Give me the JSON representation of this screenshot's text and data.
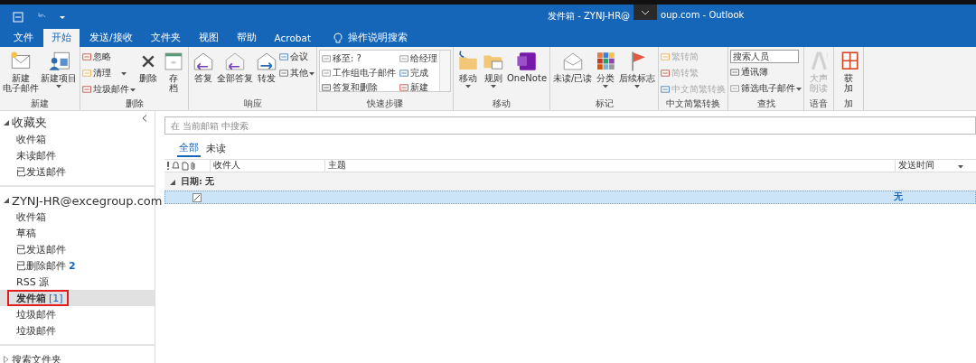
{
  "window": {
    "title_before": "发件箱 - ZYNJ-HR@",
    "title_after": "oup.com  -  Outlook"
  },
  "menu_tabs": [
    {
      "label": "文件",
      "selected": false
    },
    {
      "label": "开始",
      "selected": true
    },
    {
      "label": "发送/接收",
      "selected": false
    },
    {
      "label": "文件夹",
      "selected": false
    },
    {
      "label": "视图",
      "selected": false
    },
    {
      "label": "帮助",
      "selected": false
    },
    {
      "label": "Acrobat",
      "selected": false
    }
  ],
  "tell_me": {
    "label": "操作说明搜索"
  },
  "ribbon": [
    {
      "label": "新建",
      "items": [
        {
          "kind": "large",
          "lines": [
            "新建",
            "电子邮件"
          ],
          "dropdown": false,
          "disabled": false
        },
        {
          "kind": "large",
          "lines": [
            "新建项目"
          ],
          "dropdown": true,
          "disabled": false
        }
      ]
    },
    {
      "label": "删除",
      "items": [
        {
          "kind": "stack",
          "entries": [
            {
              "label": "忽略",
              "dropdown": false,
              "disabled": false
            },
            {
              "label": "清理",
              "dropdown": true,
              "disabled": false
            },
            {
              "label": "垃圾邮件",
              "dropdown": true,
              "disabled": false
            }
          ]
        },
        {
          "kind": "large",
          "lines": [
            "删除"
          ],
          "dropdown": false,
          "disabled": false
        },
        {
          "kind": "large",
          "lines": [
            "存",
            "档"
          ],
          "dropdown": false,
          "disabled": false
        }
      ]
    },
    {
      "label": "响应",
      "items": [
        {
          "kind": "large",
          "lines": [
            "答复"
          ],
          "dropdown": false,
          "disabled": false
        },
        {
          "kind": "large",
          "lines": [
            "全部答复"
          ],
          "dropdown": false,
          "disabled": false
        },
        {
          "kind": "large",
          "lines": [
            "转发"
          ],
          "dropdown": false,
          "disabled": false
        },
        {
          "kind": "stack",
          "entries": [
            {
              "label": "会议",
              "dropdown": false,
              "disabled": false
            },
            {
              "label": "其他",
              "dropdown": true,
              "disabled": false
            }
          ]
        }
      ]
    },
    {
      "label": "快速步骤",
      "items": [
        {
          "kind": "gallery",
          "entries": [
            {
              "label": "移至: ?"
            },
            {
              "label": "给经理"
            },
            {
              "label": "工作组电子邮件"
            },
            {
              "label": "完成"
            },
            {
              "label": "答复和删除"
            },
            {
              "label": "新建"
            }
          ]
        }
      ]
    },
    {
      "label": "移动",
      "items": [
        {
          "kind": "large",
          "lines": [
            "移动"
          ],
          "dropdown": true,
          "disabled": false
        },
        {
          "kind": "large",
          "lines": [
            "规则"
          ],
          "dropdown": true,
          "disabled": false
        },
        {
          "kind": "large",
          "lines": [
            "OneNote"
          ],
          "dropdown": false,
          "disabled": false
        }
      ]
    },
    {
      "label": "标记",
      "items": [
        {
          "kind": "large",
          "lines": [
            "未读/已读"
          ],
          "dropdown": false,
          "disabled": false
        },
        {
          "kind": "large",
          "lines": [
            "分类"
          ],
          "dropdown": true,
          "disabled": false
        },
        {
          "kind": "large",
          "lines": [
            "后续标志"
          ],
          "dropdown": true,
          "disabled": false
        }
      ]
    },
    {
      "label": "中文简繁转换",
      "items": [
        {
          "kind": "stack",
          "entries": [
            {
              "label": "繁转简",
              "dropdown": false,
              "disabled": true
            },
            {
              "label": "简转繁",
              "dropdown": false,
              "disabled": true
            },
            {
              "label": "中文简繁转换",
              "dropdown": false,
              "disabled": true
            }
          ]
        }
      ]
    },
    {
      "label": "查找",
      "items": [
        {
          "kind": "find",
          "placeholder": "搜索人员",
          "entries": [
            {
              "label": "通讯簿",
              "dropdown": false,
              "disabled": false
            },
            {
              "label": "筛选电子邮件",
              "dropdown": true,
              "disabled": false
            }
          ]
        }
      ]
    },
    {
      "label": "语音",
      "items": [
        {
          "kind": "large",
          "lines": [
            "大声",
            "朗读"
          ],
          "dropdown": false,
          "disabled": true
        }
      ]
    },
    {
      "label": "加",
      "items": [
        {
          "kind": "large",
          "lines": [
            "获",
            "加"
          ],
          "dropdown": false,
          "disabled": false
        }
      ]
    }
  ],
  "nav": [
    {
      "label": "收藏夹",
      "expanded": true,
      "children": [
        {
          "label": "收件箱",
          "selected": false,
          "highlighted": false
        },
        {
          "label": "未读邮件",
          "selected": false,
          "highlighted": false
        },
        {
          "label": "已发送邮件",
          "selected": false,
          "highlighted": false
        }
      ]
    },
    {
      "label": "ZYNJ-HR@excegroup.com",
      "expanded": true,
      "children": [
        {
          "label": "收件箱",
          "selected": false,
          "highlighted": false
        },
        {
          "label": "草稿",
          "selected": false,
          "highlighted": false
        },
        {
          "label": "已发送邮件",
          "selected": false,
          "highlighted": false
        },
        {
          "label": "已删除邮件",
          "count": "2",
          "selected": false,
          "highlighted": false
        },
        {
          "label": "RSS 源",
          "selected": false,
          "highlighted": false
        },
        {
          "label": "发件箱",
          "count": "[1]",
          "selected": true,
          "highlighted": true
        },
        {
          "label": "垃圾邮件",
          "selected": false,
          "highlighted": false
        },
        {
          "label": "垃圾邮件",
          "selected": false,
          "highlighted": false
        }
      ]
    },
    {
      "label": "搜索文件夹",
      "expanded": false
    }
  ],
  "search": {
    "placeholder": "在 当前邮箱 中搜索"
  },
  "filters": [
    {
      "label": "全部",
      "selected": true
    },
    {
      "label": "未读",
      "selected": false
    }
  ],
  "table": {
    "columns": [
      "收件人",
      "主题",
      "发送时间"
    ],
    "groups": [
      {
        "label": "日期: 无",
        "expanded": true,
        "rows": [
          {
            "selected": true,
            "sent": "无"
          }
        ]
      }
    ]
  }
}
